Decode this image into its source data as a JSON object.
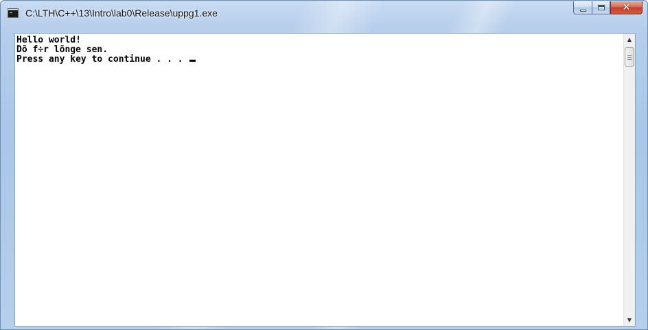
{
  "window": {
    "title": "C:\\LTH\\C++\\13\\Intro\\lab0\\Release\\uppg1.exe",
    "icon": "console-app-icon",
    "controls": {
      "minimize": "minimize-icon",
      "maximize": "maximize-icon",
      "close": "close-icon",
      "close_glyph": "✕"
    }
  },
  "console": {
    "lines": [
      "Hello world!",
      "Dõ f÷r lõnge sen.",
      "Press any key to continue . . . "
    ],
    "cursor": "_"
  },
  "scrollbar": {
    "up_glyph": "▲",
    "down_glyph": "▼"
  },
  "colors": {
    "frame": "#aac6e8",
    "console_bg": "#ffffff",
    "console_text": "#000000",
    "close_button": "#c2412c"
  }
}
